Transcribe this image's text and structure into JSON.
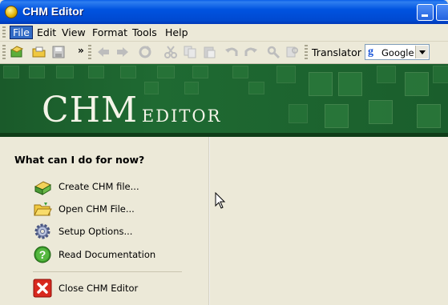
{
  "window": {
    "title": "CHM Editor"
  },
  "menu": [
    "File",
    "Edit",
    "View",
    "Format",
    "Tools",
    "Help"
  ],
  "toolbar": {
    "overflow_label": "»",
    "translator_label": "Translator",
    "translator_selected": "Google",
    "translator_logo": "g"
  },
  "banner": {
    "title_big": "CHM",
    "title_small": "editor"
  },
  "panel": {
    "heading": "What can I do for now?",
    "actions": [
      {
        "label": "Create CHM file...",
        "icon": "create-book-icon"
      },
      {
        "label": "Open CHM File...",
        "icon": "open-folder-icon"
      },
      {
        "label": "Setup Options...",
        "icon": "gear-icon"
      },
      {
        "label": "Read Documentation",
        "icon": "help-icon"
      },
      {
        "label": "Close CHM Editor",
        "icon": "close-icon"
      }
    ]
  },
  "colors": {
    "titlebar": "#0054e3",
    "banner": "#1f6a32",
    "menu_highlight": "#316ac5",
    "face": "#ece9d8"
  }
}
